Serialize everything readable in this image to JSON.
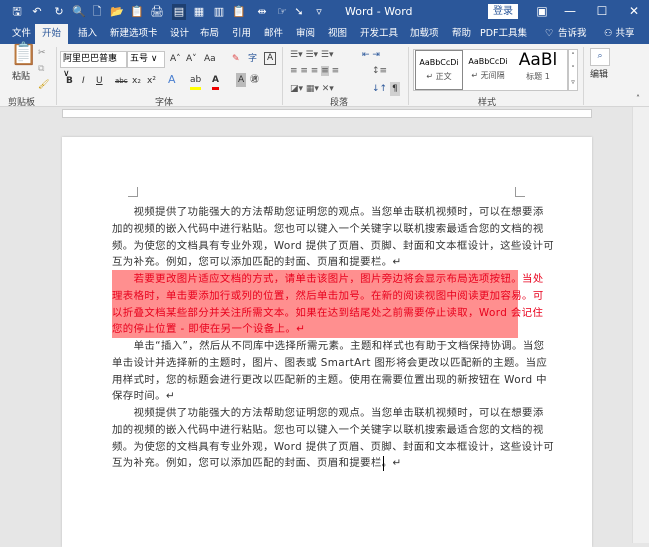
{
  "window": {
    "title": "Word - Word",
    "login": "登录",
    "minimize": "—",
    "maximize": "☐",
    "close": "✕"
  },
  "qat": [
    "🖫",
    "↶",
    "↻",
    "🔍",
    "🗋",
    "📂",
    "📋",
    "🖨",
    "▤",
    "▦",
    "▥",
    "📋",
    "⇹",
    "☞",
    "➘",
    "▿"
  ],
  "tabs": [
    "文件",
    "开始",
    "插入",
    "新建选项卡",
    "设计",
    "布局",
    "引用",
    "邮件",
    "审阅",
    "视图",
    "开发工具",
    "加载项",
    "帮助",
    "PDF工具集"
  ],
  "tell_me": "告诉我",
  "share": "共享",
  "ribbon": {
    "clipboard": {
      "paste": "粘贴",
      "label": "剪贴板"
    },
    "font": {
      "name": "阿里巴巴普惠",
      "size": "五号",
      "label": "字体",
      "bold": "B",
      "italic": "I",
      "underline": "U",
      "strike": "abc",
      "sub": "x₂",
      "sup": "x²",
      "grow": "A˄",
      "shrink": "A˅",
      "case": "Aa"
    },
    "paragraph": {
      "label": "段落"
    },
    "styles": {
      "label": "样式",
      "items": [
        {
          "preview": "AaBbCcDi",
          "name": "↵ 正文"
        },
        {
          "preview": "AaBbCcDi",
          "name": "↵ 无间隔"
        },
        {
          "preview": "AaBl",
          "name": "标题 1"
        }
      ]
    },
    "editing": {
      "label": "编辑"
    }
  },
  "document": {
    "p1": [
      "　　视频提供了功能强大的方法帮助您证明您的观点。当您单击联机视频时，可以在想要添",
      "加的视频的嵌入代码中进行粘贴。您也可以键入一个关键字以联机搜索最适合您的文档的视",
      "频。为使您的文档具有专业外观，Word 提供了页眉、页脚、封面和文本框设计，这些设计可",
      "互为补充。例如，您可以添加匹配的封面、页眉和提要栏。↵"
    ],
    "p2": [
      "　　若要更改图片适应文档的方式，请单击该图片，图片旁边将会显示布局选项按钮。当处",
      "理表格时，单击要添加行或列的位置，然后单击加号。在新的阅读视图中阅读更加容易。可",
      "以折叠文档某些部分并关注所需文本。如果在达到结尾处之前需要停止读取，Word 会记住",
      "您的停止位置 - 即使在另一个设备上。↵"
    ],
    "p3": [
      "　　单击“插入”，然后从不同库中选择所需元素。主题和样式也有助于文档保持协调。当您",
      "单击设计并选择新的主题时，图片、图表或 SmartArt 图形将会更改以匹配新的主题。当应",
      "用样式时，您的标题会进行更改以匹配新的主题。使用在需要位置出现的新按钮在 Word 中",
      "保存时间。↵"
    ],
    "p4": [
      "　　视频提供了功能强大的方法帮助您证明您的观点。当您单击联机视频时，可以在想要添",
      "加的视频的嵌入代码中进行粘贴。您也可以键入一个关键字以联机搜索最适合您的文档的视",
      "频。为使您的文档具有专业外观，Word 提供了页眉、页脚、封面和文本框设计，这些设计可",
      "互为补充。例如，您可以添加匹配的封面、页眉和提要栏。↵"
    ]
  },
  "colors": {
    "brand": "#2b579a",
    "highlight": "#ff8f8f",
    "red_text": "#e8001c"
  }
}
